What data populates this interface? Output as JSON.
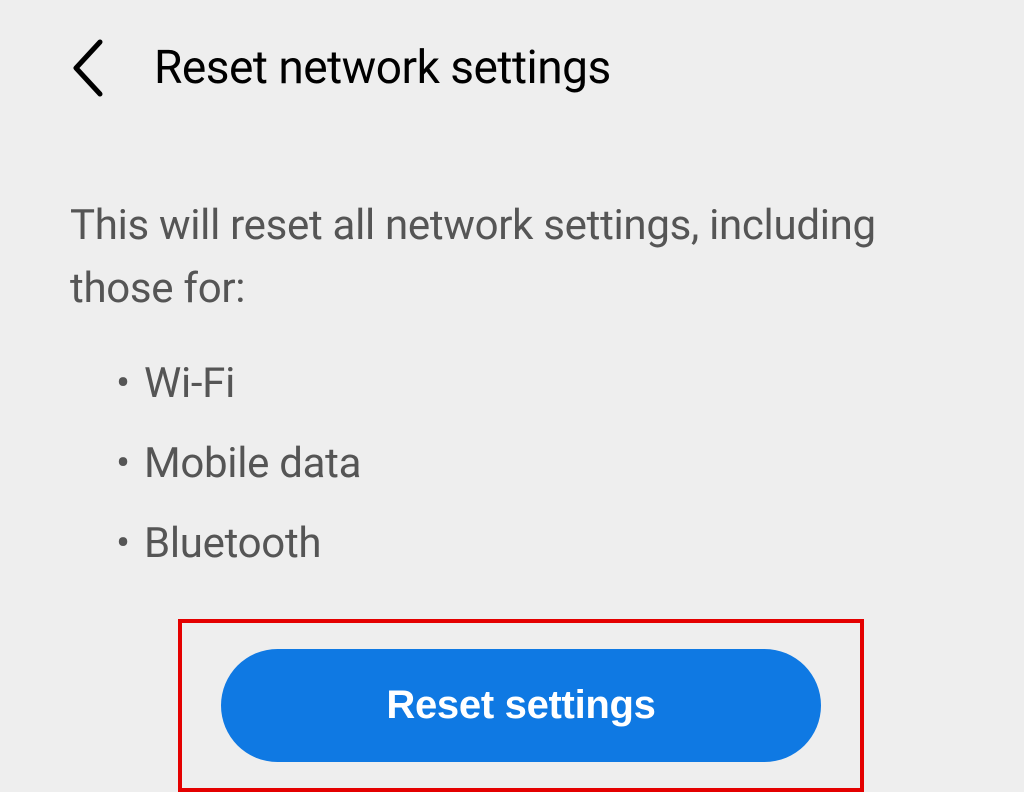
{
  "header": {
    "title": "Reset network settings"
  },
  "body": {
    "description": "This will reset all network settings, including those for:",
    "items": [
      "Wi-Fi",
      "Mobile data",
      "Bluetooth"
    ]
  },
  "action": {
    "reset_label": "Reset settings"
  },
  "colors": {
    "button_bg": "#0f79e3",
    "highlight_border": "#e40000"
  }
}
